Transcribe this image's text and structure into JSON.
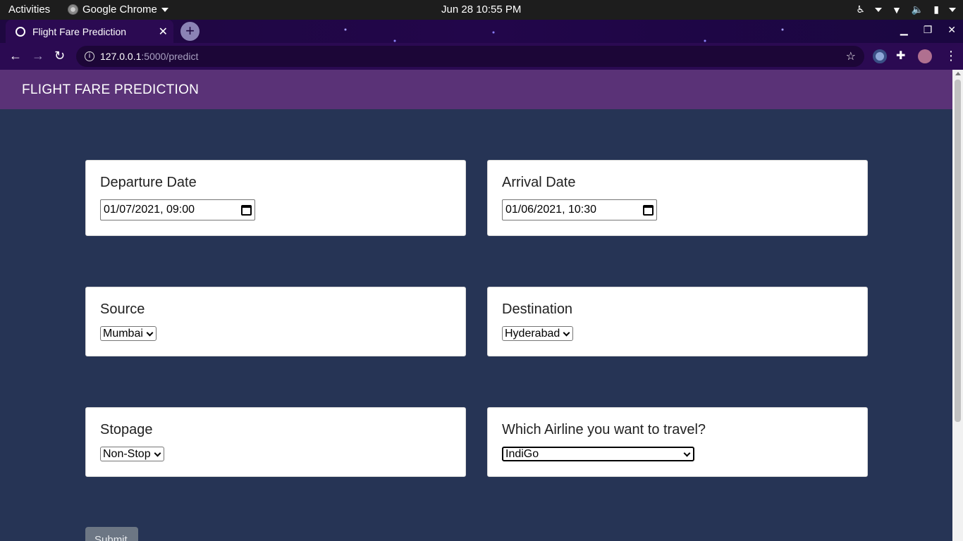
{
  "system": {
    "activities": "Activities",
    "app_name": "Google Chrome",
    "clock": "Jun 28  10:55 PM"
  },
  "browser": {
    "tab_title": "Flight Fare Prediction",
    "url_host": "127.0.0.1",
    "url_path": ":5000/predict"
  },
  "site": {
    "header": "FLIGHT FARE PREDICTION"
  },
  "form": {
    "departure": {
      "label": "Departure Date",
      "value": "01/07/2021, 09:00"
    },
    "arrival": {
      "label": "Arrival Date",
      "value": "01/06/2021, 10:30"
    },
    "source": {
      "label": "Source",
      "value": "Mumbai"
    },
    "destination": {
      "label": "Destination",
      "value": "Hyderabad"
    },
    "stopage": {
      "label": "Stopage",
      "value": "Non-Stop"
    },
    "airline": {
      "label": "Which Airline you want to travel?",
      "value": "IndiGo"
    },
    "submit_label": "Submit"
  },
  "colors": {
    "header_bg": "#5a3277",
    "page_bg": "#263455",
    "submit_bg": "#6c7684"
  }
}
